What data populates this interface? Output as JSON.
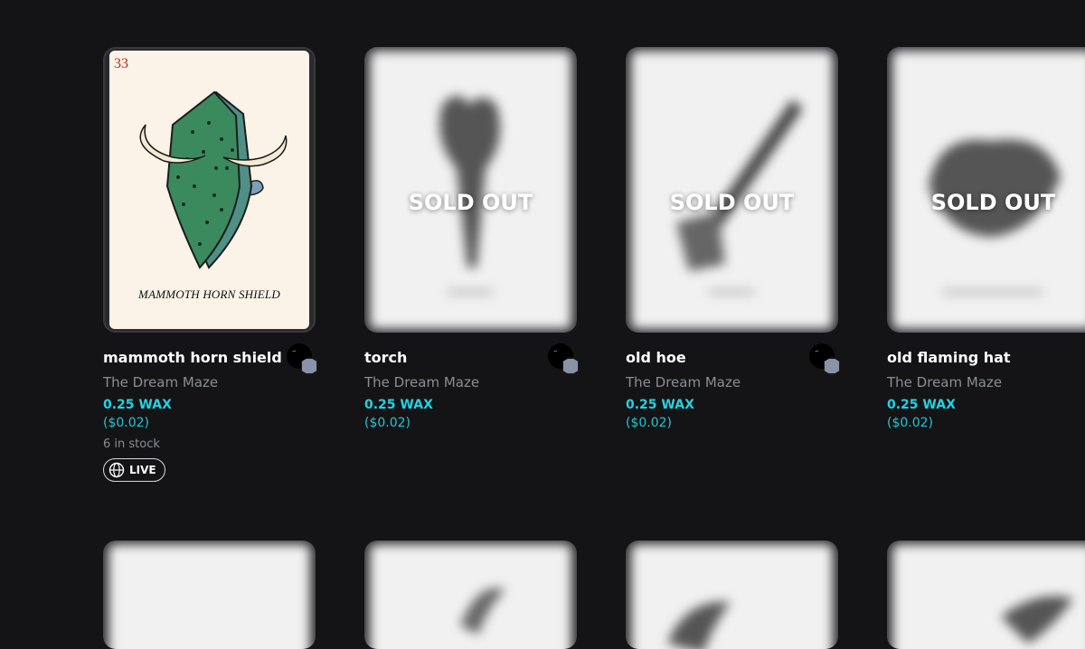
{
  "colors": {
    "background": "#141416",
    "accent": "#22d3e3",
    "muted": "#8b8d96"
  },
  "cards": [
    {
      "title": "mammoth horn shield",
      "collection": "The Dream Maze",
      "price": "0.25 WAX",
      "usd": "($0.02)",
      "stock": "6 in stock",
      "badge": "LIVE",
      "card_number": "33",
      "art_caption": "MAMMOTH HORN SHIELD",
      "sold_out": false
    },
    {
      "title": "torch",
      "collection": "The Dream Maze",
      "price": "0.25 WAX",
      "usd": "($0.02)",
      "sold_out": true,
      "sold_label": "SOLD OUT"
    },
    {
      "title": "old hoe",
      "collection": "The Dream Maze",
      "price": "0.25 WAX",
      "usd": "($0.02)",
      "sold_out": true,
      "sold_label": "SOLD OUT"
    },
    {
      "title": "old flaming hat",
      "collection": "The Dream Maze",
      "price": "0.25 WAX",
      "usd": "($0.02)",
      "sold_out": true,
      "sold_label": "SOLD OUT"
    }
  ],
  "icons": {
    "globe": "globe-icon",
    "verified": "verified-badge-icon",
    "avatar": "collection-avatar"
  }
}
